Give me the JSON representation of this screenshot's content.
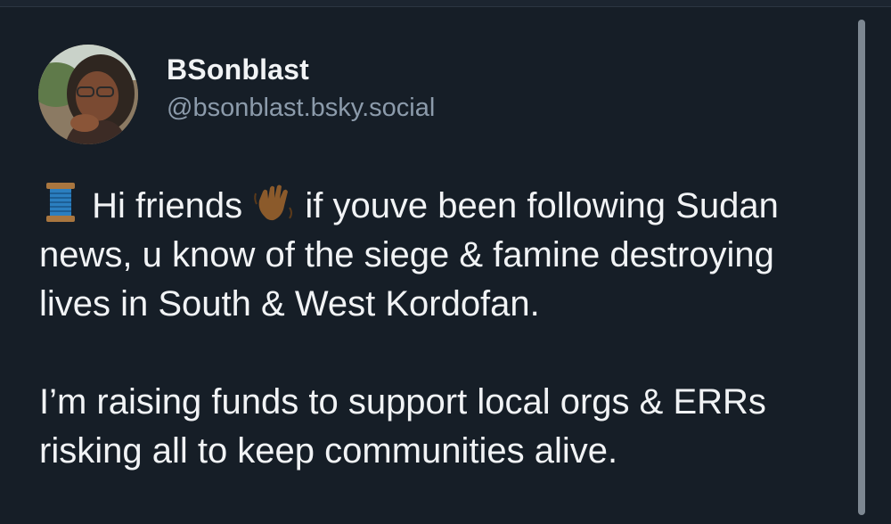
{
  "post": {
    "author": {
      "display_name": "BSonblast",
      "handle": "@bsonblast.bsky.social"
    },
    "paragraphs": [
      {
        "lead_emoji": "spool-of-thread",
        "part1": "Hi friends",
        "mid_emoji": "waving-hand",
        "part2": "if youve been following Sudan news, u know of the siege & famine destroying lives in South & West Kordofan."
      },
      {
        "text": "I’m raising funds to support local orgs & ERRs risking all to keep communities alive."
      }
    ]
  },
  "colors": {
    "background": "#161e27",
    "text_primary": "#f1f3f5",
    "text_secondary": "#8c9bab",
    "scrollbar": "#7d8791"
  }
}
